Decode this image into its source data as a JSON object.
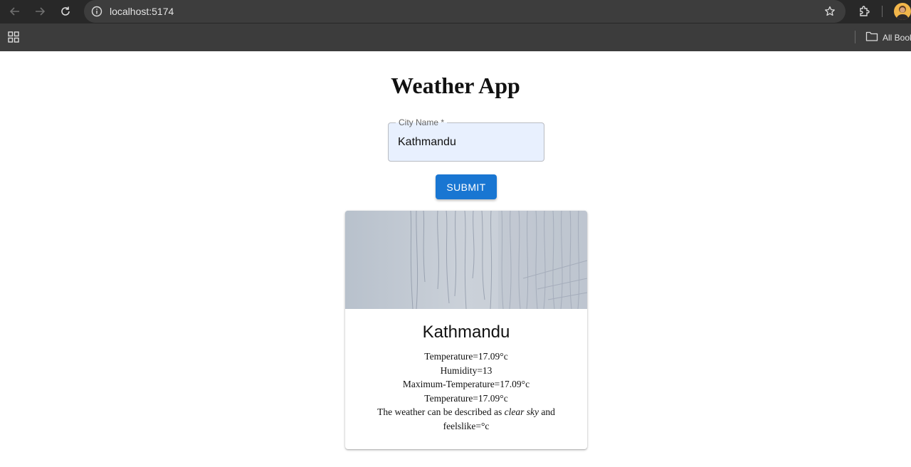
{
  "browser": {
    "url": "localhost:5174",
    "bookmarks_label": "All Bookmarks"
  },
  "app": {
    "title": "Weather App",
    "city_field": {
      "label": "City Name *",
      "value": "Kathmandu"
    },
    "submit_label": "SUBMIT"
  },
  "card": {
    "city": "Kathmandu",
    "temperature": "Temperature=17.09°c",
    "humidity": "Humidity=13",
    "max_temperature": "Maximum-Temperature=17.09°c",
    "temperature_2": "Temperature=17.09°c",
    "description_prefix": "The weather can be described as",
    "description_value": "clear sky",
    "description_suffix": "and",
    "feelslike": "feelslike=°c"
  },
  "colors": {
    "accent": "#1976d2",
    "input_bg": "#e8f0fe"
  },
  "icons": [
    "back-icon",
    "forward-icon",
    "reload-icon",
    "site-info-icon",
    "star-icon",
    "extensions-icon",
    "apps-grid-icon",
    "folder-icon",
    "profile-avatar"
  ]
}
